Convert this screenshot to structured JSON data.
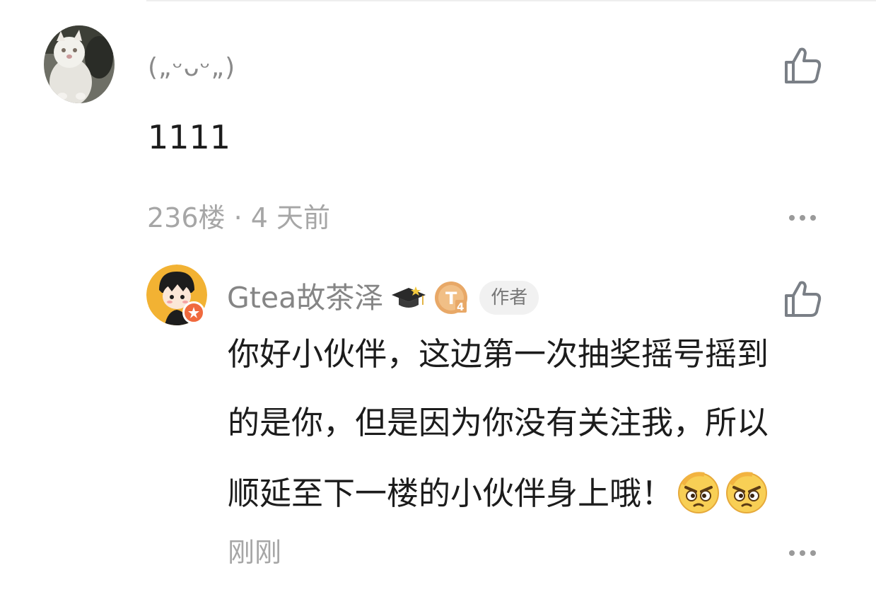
{
  "comment": {
    "username": "(„ᵕᴗᵕ„)",
    "text": "1111",
    "floor": "236楼",
    "dot": " · ",
    "time": "4 天前",
    "avatar_icon": "cat-avatar",
    "like_icon": "thumbs-up-icon",
    "more_icon": "more-dots-icon"
  },
  "reply": {
    "username": "Gtea故茶泽",
    "level_badge": "T",
    "level_badge_sub": "4",
    "author_tag": "作者",
    "lines": [
      "你好小伙伴，这边第一次抽奖摇号摇到",
      "的是你，但是因为你没有关注我，所以",
      "顺延至下一楼的小伙伴身上哦！"
    ],
    "time": "刚刚",
    "avatar_icon": "cartoon-boy-avatar",
    "emoji_icon": "glaring-face-emoji",
    "graduation_icon": "graduation-cap-icon"
  },
  "colors": {
    "text_primary": "#1c1c1c",
    "text_secondary": "#8a8a8a",
    "meta": "#a6a6a6",
    "badge_orange": "#e8a867",
    "avatar_badge": "#f06a3e"
  }
}
